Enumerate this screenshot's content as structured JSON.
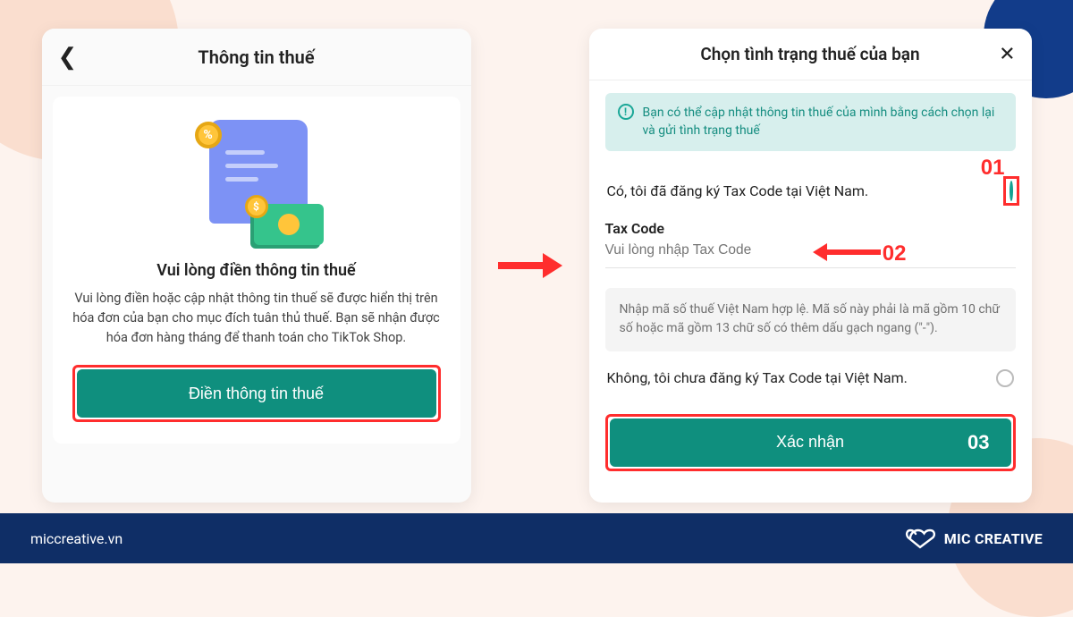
{
  "left": {
    "header_title": "Thông tin thuế",
    "subtitle": "Vui lòng điền thông tin thuế",
    "description": "Vui lòng điền hoặc cập nhật thông tin thuế sẽ được hiển thị trên hóa đơn của bạn cho mục đích tuân thủ thuế. Bạn sẽ nhận được hóa đơn hàng tháng để thanh toán cho TikTok Shop.",
    "cta_label": "Điền thông tin thuế"
  },
  "right": {
    "header_title": "Chọn tình trạng thuế của bạn",
    "info_banner": "Bạn có thể cập nhật thông tin thuế của mình bằng cách chọn lại và gửi tình trạng thuế",
    "option_yes": "Có, tôi đã đăng ký Tax Code tại Việt Nam.",
    "taxcode_label": "Tax Code",
    "taxcode_placeholder": "Vui lòng nhập Tax Code",
    "note": "Nhập mã số thuế Việt Nam hợp lệ. Mã số này phải là mã gồm 10 chữ số hoặc mã gồm 13 chữ số có thêm dấu gạch ngang (\"-\").",
    "option_no": "Không, tôi chưa đăng ký Tax Code tại Việt Nam.",
    "confirm_label": "Xác nhận",
    "step_labels": {
      "one": "01",
      "two": "02",
      "three": "03"
    }
  },
  "footer": {
    "site": "miccreative.vn",
    "brand": "MIC CREATIVE"
  }
}
